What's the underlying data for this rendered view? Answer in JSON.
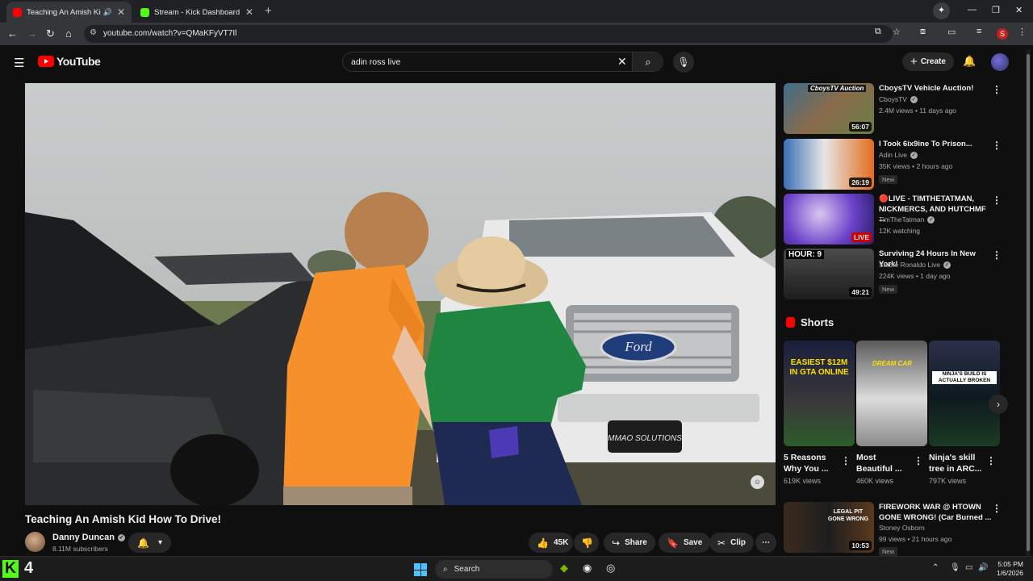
{
  "browser": {
    "tabs": [
      {
        "title": "Teaching An Amish Kid How",
        "active": true,
        "favicon_color": "#ff0000"
      },
      {
        "title": "Stream - Kick Dashboard",
        "active": false,
        "favicon_color": "#53fc18"
      }
    ],
    "url": "youtube.com/watch?v=QMaKFyVT7Il",
    "profile_initial": "S"
  },
  "youtube": {
    "logo_text": "YouTube",
    "search_value": "adin ross live",
    "create_label": "Create"
  },
  "video": {
    "title": "Teaching An Amish Kid How To Drive!",
    "plate_text": "MMAO SOLUTIONS",
    "channel": {
      "name": "Danny Duncan",
      "subscribers": "8.11M subscribers"
    },
    "actions": {
      "likes": "45K",
      "share": "Share",
      "save": "Save",
      "clip": "Clip"
    }
  },
  "recommendations": [
    {
      "title": "CboysTV Vehicle Auction!",
      "channel": "CboysTV",
      "meta": "2.4M views • 11 days ago",
      "duration": "56:07",
      "thumb_text": "CboysTV Auction",
      "badge": ""
    },
    {
      "title": "I Took 6ix9ine To Prison...",
      "channel": "Adin Live",
      "meta": "35K views • 2 hours ago",
      "duration": "26:19",
      "thumb_text": "",
      "badge": "New"
    },
    {
      "title": "🔴LIVE - TIMTHETATMAN, NICKMERCS, AND HUTCHMF ...",
      "channel": "TimTheTatman",
      "meta": "12K watching",
      "duration": "LIVE",
      "thumb_text": "",
      "badge": ""
    },
    {
      "title": "Surviving 24 Hours In New York!",
      "channel": "Stable Ronaldo Live",
      "meta": "224K views • 1 day ago",
      "duration": "49:21",
      "thumb_text": "HOUR: 9",
      "badge": "New"
    }
  ],
  "shorts": {
    "heading": "Shorts",
    "items": [
      {
        "title": "5 Reasons Why You ...",
        "views": "619K views",
        "thumb_text": "EASIEST $12M IN GTA ONLINE"
      },
      {
        "title": "Most Beautiful ...",
        "views": "460K views",
        "thumb_text": "DREAM CAR"
      },
      {
        "title": "Ninja's skill tree in ARC...",
        "views": "797K views",
        "thumb_text": "NINJA'S BUILD IS ACTUALLY BROKEN"
      }
    ]
  },
  "recommendation_bottom": {
    "title": "FIREWORK WAR @ HTOWN GONE WRONG! (Car Burned ...",
    "channel": "Stoney Osborn",
    "meta": "99 views • 21 hours ago",
    "duration": "10:53",
    "badge": "New",
    "thumb_text": "LEGAL PIT GONE WRONG"
  },
  "taskbar": {
    "kick_count": "4",
    "search_placeholder": "Search",
    "time": "5:05 PM",
    "date": "1/6/2026"
  }
}
